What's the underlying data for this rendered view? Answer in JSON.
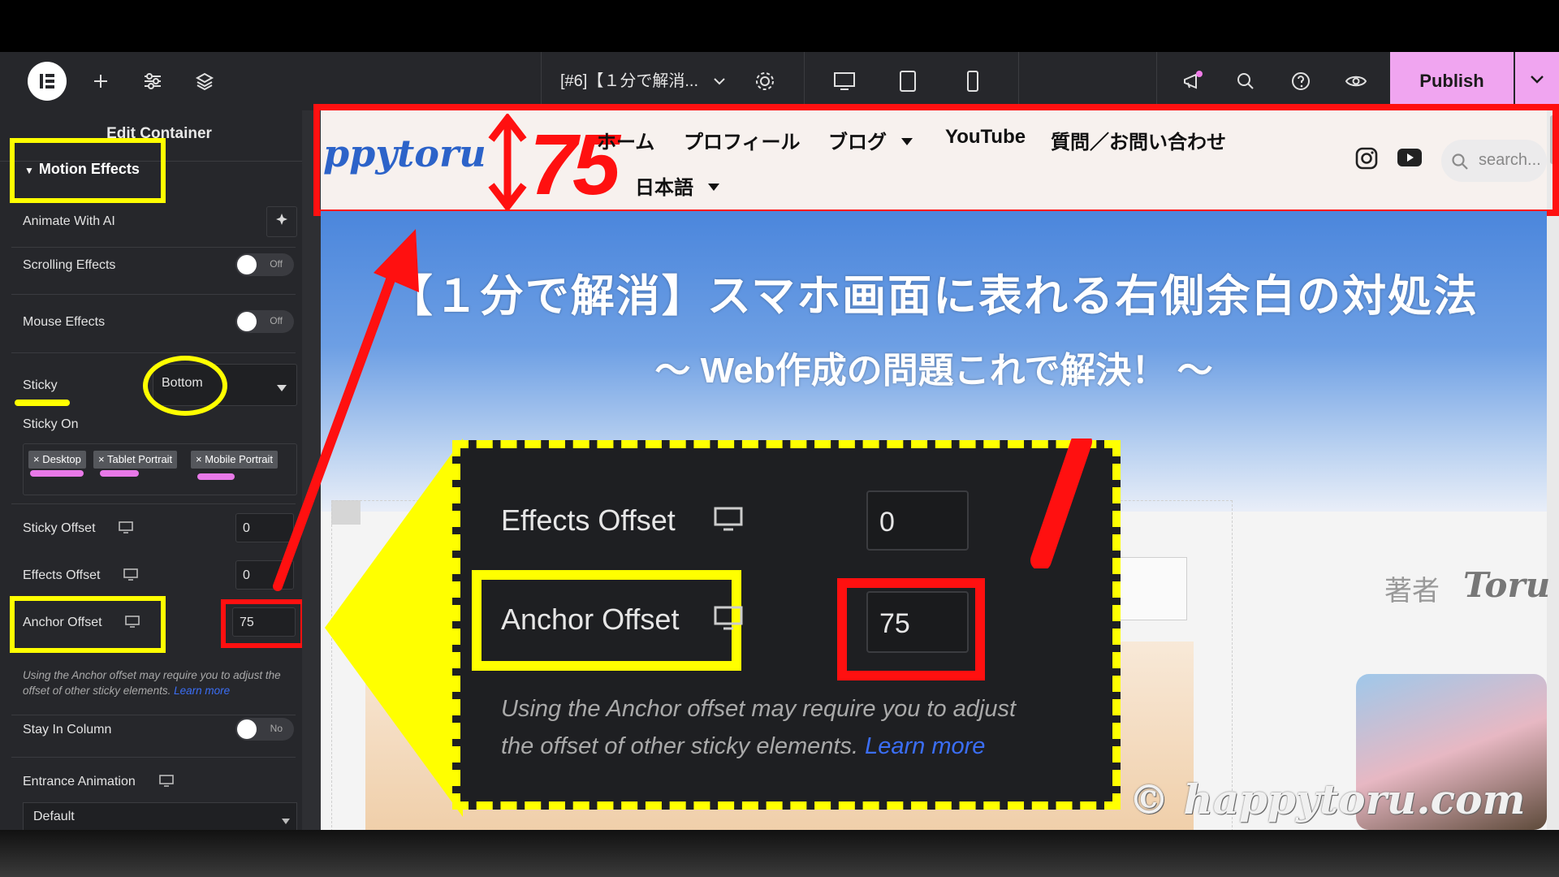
{
  "topbar": {
    "doc_title": "[#6]【１分で解消...",
    "publish_label": "Publish"
  },
  "panel": {
    "header": "Edit Container",
    "section_title": "Motion Effects",
    "animate_ai_label": "Animate With AI",
    "scrolling_effects": {
      "label": "Scrolling Effects",
      "state": "Off"
    },
    "mouse_effects": {
      "label": "Mouse Effects",
      "state": "Off"
    },
    "sticky": {
      "label": "Sticky",
      "value": "Bottom"
    },
    "sticky_on": {
      "label": "Sticky On",
      "chips": [
        "× Desktop",
        "× Tablet Portrait",
        "× Mobile Portrait"
      ]
    },
    "sticky_offset": {
      "label": "Sticky Offset",
      "value": "0"
    },
    "effects_offset": {
      "label": "Effects Offset",
      "value": "0"
    },
    "anchor_offset": {
      "label": "Anchor Offset",
      "value": "75"
    },
    "help_text": "Using the Anchor offset may require you to adjust the offset of other sticky elements.",
    "help_link": "Learn more",
    "stay_in_column": {
      "label": "Stay In Column",
      "state": "No"
    },
    "entrance_animation": {
      "label": "Entrance Animation",
      "value": "Default"
    }
  },
  "site": {
    "logo_text": "ppytoru",
    "annotation_number": "75",
    "nav": [
      "ホーム",
      "プロフィール",
      "ブログ",
      "YouTube",
      "質問／お問い合わせ"
    ],
    "language": "日本語",
    "search_placeholder": "search...",
    "hero_title": "【１分で解消】スマホ画面に表れる右側余白の対処法",
    "hero_subtitle": "〜 Web作成の問題これで解決！ 〜",
    "author_label": "著者",
    "author_name": "Toru",
    "watermark": "© happytoru.com"
  },
  "zoom": {
    "effects_offset_label": "Effects Offset",
    "effects_offset_value": "0",
    "anchor_offset_label": "Anchor Offset",
    "anchor_offset_value": "75",
    "help_text_line1": "Using the Anchor offset may require you to adjust",
    "help_text_line2": "the offset of other sticky elements.",
    "help_link": "Learn more"
  },
  "colors": {
    "panel_bg": "#26272b",
    "publish_bg": "#f0a5f0",
    "highlight_yellow": "#ffff00",
    "highlight_red": "#ff0000",
    "link_blue": "#3b6ef5"
  }
}
